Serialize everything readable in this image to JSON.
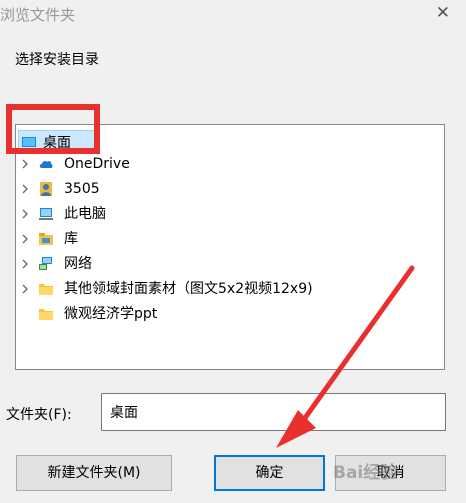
{
  "window": {
    "title": "浏览文件夹",
    "close_glyph": "✕"
  },
  "prompt": "选择安装目录",
  "tree": {
    "items": [
      {
        "label": "桌面",
        "icon": "desktop-icon",
        "has_chevron": false,
        "selected": true
      },
      {
        "label": "OneDrive",
        "icon": "cloud-icon",
        "has_chevron": true
      },
      {
        "label": "3505",
        "icon": "user-icon",
        "has_chevron": true
      },
      {
        "label": "此电脑",
        "icon": "computer-icon",
        "has_chevron": true
      },
      {
        "label": "库",
        "icon": "library-icon",
        "has_chevron": true
      },
      {
        "label": "网络",
        "icon": "network-icon",
        "has_chevron": true
      },
      {
        "label": "其他领域封面素材（图文5x2视频12x9)",
        "icon": "folder-icon",
        "has_chevron": true
      },
      {
        "label": "微观经济学ppt",
        "icon": "folder-icon",
        "has_chevron": false
      }
    ]
  },
  "folder": {
    "label": "文件夹(F):",
    "value": "桌面"
  },
  "buttons": {
    "new_folder": "新建文件夹(M)",
    "ok": "确定",
    "cancel": "取消"
  },
  "watermark": "Bai经验",
  "colors": {
    "highlight": "#e8312f",
    "selection": "#cce8ff",
    "accent": "#0078d7"
  }
}
